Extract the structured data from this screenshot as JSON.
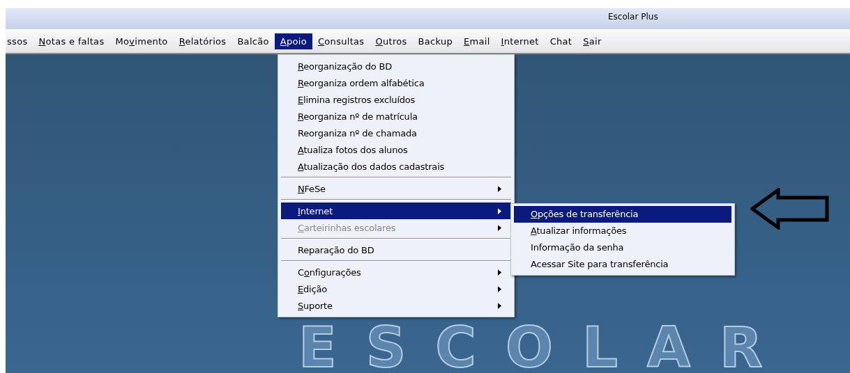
{
  "window": {
    "title": "Escolar Plus"
  },
  "menu_bar": [
    {
      "label": [
        {
          "text": "ssos",
          "underlined": false
        }
      ],
      "selected": false
    },
    {
      "label": [
        {
          "text": "N",
          "underlined": true
        },
        {
          "text": "otas e faltas",
          "underlined": false
        }
      ],
      "selected": false
    },
    {
      "label": [
        {
          "text": "Mo",
          "underlined": false
        },
        {
          "text": "v",
          "underlined": true
        },
        {
          "text": "imento",
          "underlined": false
        }
      ],
      "selected": false
    },
    {
      "label": [
        {
          "text": "R",
          "underlined": true
        },
        {
          "text": "elatórios",
          "underlined": false
        }
      ],
      "selected": false
    },
    {
      "label": [
        {
          "text": "Balcão",
          "underlined": false
        }
      ],
      "selected": false
    },
    {
      "label": [
        {
          "text": "A",
          "underlined": true
        },
        {
          "text": "poio",
          "underlined": false
        }
      ],
      "selected": true
    },
    {
      "label": [
        {
          "text": "C",
          "underlined": true
        },
        {
          "text": "onsultas",
          "underlined": false
        }
      ],
      "selected": false
    },
    {
      "label": [
        {
          "text": "O",
          "underlined": true
        },
        {
          "text": "utros",
          "underlined": false
        }
      ],
      "selected": false
    },
    {
      "label": [
        {
          "text": "Backup",
          "underlined": false
        }
      ],
      "selected": false
    },
    {
      "label": [
        {
          "text": "E",
          "underlined": true
        },
        {
          "text": "mail",
          "underlined": false
        }
      ],
      "selected": false
    },
    {
      "label": [
        {
          "text": "I",
          "underlined": true
        },
        {
          "text": "nternet",
          "underlined": false
        }
      ],
      "selected": false
    },
    {
      "label": [
        {
          "text": "Chat",
          "underlined": false
        }
      ],
      "selected": false
    },
    {
      "label": [
        {
          "text": "S",
          "underlined": true
        },
        {
          "text": "air",
          "underlined": false
        }
      ],
      "selected": false
    }
  ],
  "dropdown": [
    {
      "kind": "item",
      "label": [
        {
          "text": "R",
          "underlined": true
        },
        {
          "text": "eorganização do BD",
          "underlined": false
        }
      ],
      "selected": false,
      "disabled": false,
      "submenu": false
    },
    {
      "kind": "item",
      "label": [
        {
          "text": "R",
          "underlined": true
        },
        {
          "text": "eorganiza ordem alfabética",
          "underlined": false
        }
      ],
      "selected": false,
      "disabled": false,
      "submenu": false
    },
    {
      "kind": "item",
      "label": [
        {
          "text": "E",
          "underlined": true
        },
        {
          "text": "limina registros excluídos",
          "underlined": false
        }
      ],
      "selected": false,
      "disabled": false,
      "submenu": false
    },
    {
      "kind": "item",
      "label": [
        {
          "text": "R",
          "underlined": true
        },
        {
          "text": "eorganiza nº de matrícula",
          "underlined": false
        }
      ],
      "selected": false,
      "disabled": false,
      "submenu": false
    },
    {
      "kind": "item",
      "label": [
        {
          "text": "Reorganiza nº de chamada",
          "underlined": false
        }
      ],
      "selected": false,
      "disabled": false,
      "submenu": false
    },
    {
      "kind": "item",
      "label": [
        {
          "text": "A",
          "underlined": true
        },
        {
          "text": "tualiza fotos dos alunos",
          "underlined": false
        }
      ],
      "selected": false,
      "disabled": false,
      "submenu": false
    },
    {
      "kind": "item",
      "label": [
        {
          "text": "A",
          "underlined": true
        },
        {
          "text": "tualização dos dados cadastrais",
          "underlined": false
        }
      ],
      "selected": false,
      "disabled": false,
      "submenu": false
    },
    {
      "kind": "separator"
    },
    {
      "kind": "item",
      "label": [
        {
          "text": "N",
          "underlined": true
        },
        {
          "text": "FeSe",
          "underlined": false
        }
      ],
      "selected": false,
      "disabled": false,
      "submenu": true
    },
    {
      "kind": "separator"
    },
    {
      "kind": "item",
      "label": [
        {
          "text": "I",
          "underlined": true
        },
        {
          "text": "nternet",
          "underlined": false
        }
      ],
      "selected": true,
      "disabled": false,
      "submenu": true
    },
    {
      "kind": "item",
      "label": [
        {
          "text": "C",
          "underlined": true
        },
        {
          "text": "arteirinhas escolares",
          "underlined": false
        }
      ],
      "selected": false,
      "disabled": true,
      "submenu": true
    },
    {
      "kind": "separator"
    },
    {
      "kind": "item",
      "label": [
        {
          "text": "Reparação do BD",
          "underlined": false
        }
      ],
      "selected": false,
      "disabled": false,
      "submenu": false
    },
    {
      "kind": "separator"
    },
    {
      "kind": "item",
      "label": [
        {
          "text": "C",
          "underlined": false
        },
        {
          "text": "o",
          "underlined": true
        },
        {
          "text": "nfigurações",
          "underlined": false
        }
      ],
      "selected": false,
      "disabled": false,
      "submenu": true
    },
    {
      "kind": "item",
      "label": [
        {
          "text": "E",
          "underlined": true
        },
        {
          "text": "dição",
          "underlined": false
        }
      ],
      "selected": false,
      "disabled": false,
      "submenu": true
    },
    {
      "kind": "item",
      "label": [
        {
          "text": "S",
          "underlined": true
        },
        {
          "text": "uporte",
          "underlined": false
        }
      ],
      "selected": false,
      "disabled": false,
      "submenu": true
    }
  ],
  "submenu": [
    {
      "label": [
        {
          "text": "O",
          "underlined": true
        },
        {
          "text": "pções de transferência",
          "underlined": false
        }
      ],
      "selected": true
    },
    {
      "label": [
        {
          "text": "A",
          "underlined": true
        },
        {
          "text": "tualizar informações",
          "underlined": false
        }
      ],
      "selected": false
    },
    {
      "label": [
        {
          "text": "Informação da senha",
          "underlined": false
        }
      ],
      "selected": false
    },
    {
      "label": [
        {
          "text": "Acessar Site para transferência",
          "underlined": false
        }
      ],
      "selected": false
    }
  ],
  "background_logo": {
    "text": "ESCOLAR"
  }
}
